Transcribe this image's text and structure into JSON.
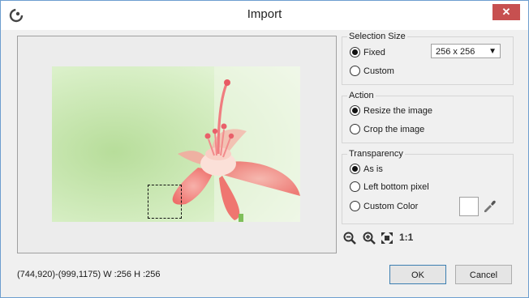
{
  "window": {
    "title": "Import",
    "close_glyph": "✕"
  },
  "selection_size": {
    "legend": "Selection Size",
    "fixed_label": "Fixed",
    "custom_label": "Custom",
    "selected": "Fixed",
    "size_value": "256 x 256"
  },
  "action": {
    "legend": "Action",
    "resize_label": "Resize the image",
    "crop_label": "Crop the image",
    "selected": "Resize the image"
  },
  "transparency": {
    "legend": "Transparency",
    "as_is_label": "As is",
    "left_bottom_label": "Left bottom pixel",
    "custom_color_label": "Custom Color",
    "selected": "As is",
    "custom_color": "#ffffff"
  },
  "zoom_tools": {
    "zoom_out_icon": "zoom-out-icon",
    "zoom_in_icon": "zoom-in-icon",
    "fit_icon": "fit-to-window-icon",
    "actual_size_label": "1:1"
  },
  "status": {
    "text": "(744,920)-(999,1175) W :256 H :256"
  },
  "buttons": {
    "ok": "OK",
    "cancel": "Cancel"
  },
  "colors": {
    "close_button": "#c75050",
    "window_border": "#6d9ecf"
  }
}
